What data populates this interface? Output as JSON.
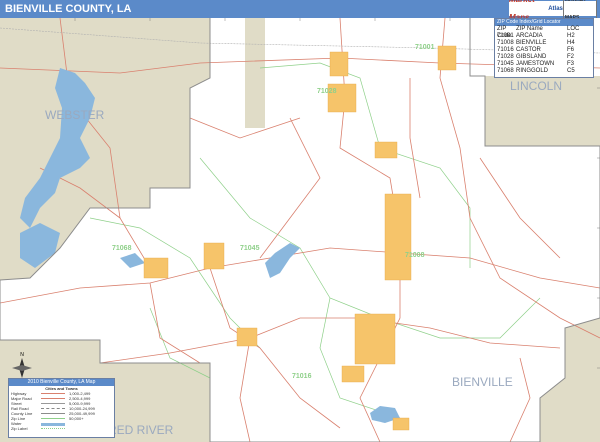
{
  "title": "BIENVILLE COUNTY, LA",
  "brand": {
    "logo": "Market Maps",
    "sub": "Atlas",
    "badge": "MARKET MAPS"
  },
  "zip_locator": {
    "heading": "ZIP Code Index/Grid Locator",
    "columns": [
      "ZIP Code",
      "ZIP Name",
      "LOC"
    ],
    "rows": [
      [
        "71001",
        "ARCADIA",
        "H2"
      ],
      [
        "71008",
        "BIENVILLE",
        "H4"
      ],
      [
        "71016",
        "CASTOR",
        "F6"
      ],
      [
        "71028",
        "GIBSLAND",
        "F2"
      ],
      [
        "71045",
        "JAMESTOWN",
        "F3"
      ],
      [
        "71068",
        "RINGGOLD",
        "C5"
      ]
    ]
  },
  "neighbor_counties": [
    "WEBSTER",
    "LINCOLN",
    "RED RIVER",
    "BIENVILLE"
  ],
  "zip_map_labels": [
    "71001",
    "71028",
    "71068",
    "71045",
    "71008",
    "71016"
  ],
  "legend": {
    "title": "2010 Bienville County, LA Map",
    "subtitle": "Cities and Towns",
    "rows": [
      {
        "label": "Highway",
        "count": "",
        "range": "1,000-2,499"
      },
      {
        "label": "Major Road",
        "count": "",
        "range": "2,500-4,999"
      },
      {
        "label": "Street",
        "count": "",
        "range": "5,000-9,999"
      },
      {
        "label": "Rail Road",
        "count": "",
        "range": "10,000-24,999"
      },
      {
        "label": "County Line",
        "count": "",
        "range": "25,000-49,999"
      },
      {
        "label": "Zip Line",
        "count": "",
        "range": "50,000+"
      },
      {
        "label": "Water",
        "count": "",
        "range": ""
      },
      {
        "label": "Zip Label",
        "count": "",
        "range": ""
      }
    ]
  },
  "compass": "N",
  "colors": {
    "title_bar": "#5b8ac9",
    "county_outside": "#e0dcc7",
    "water": "#8ab7dd",
    "town": "#f6c46a",
    "road": "#d9806e",
    "zip_line": "#8fd08a",
    "label": "#9aa9bf"
  }
}
